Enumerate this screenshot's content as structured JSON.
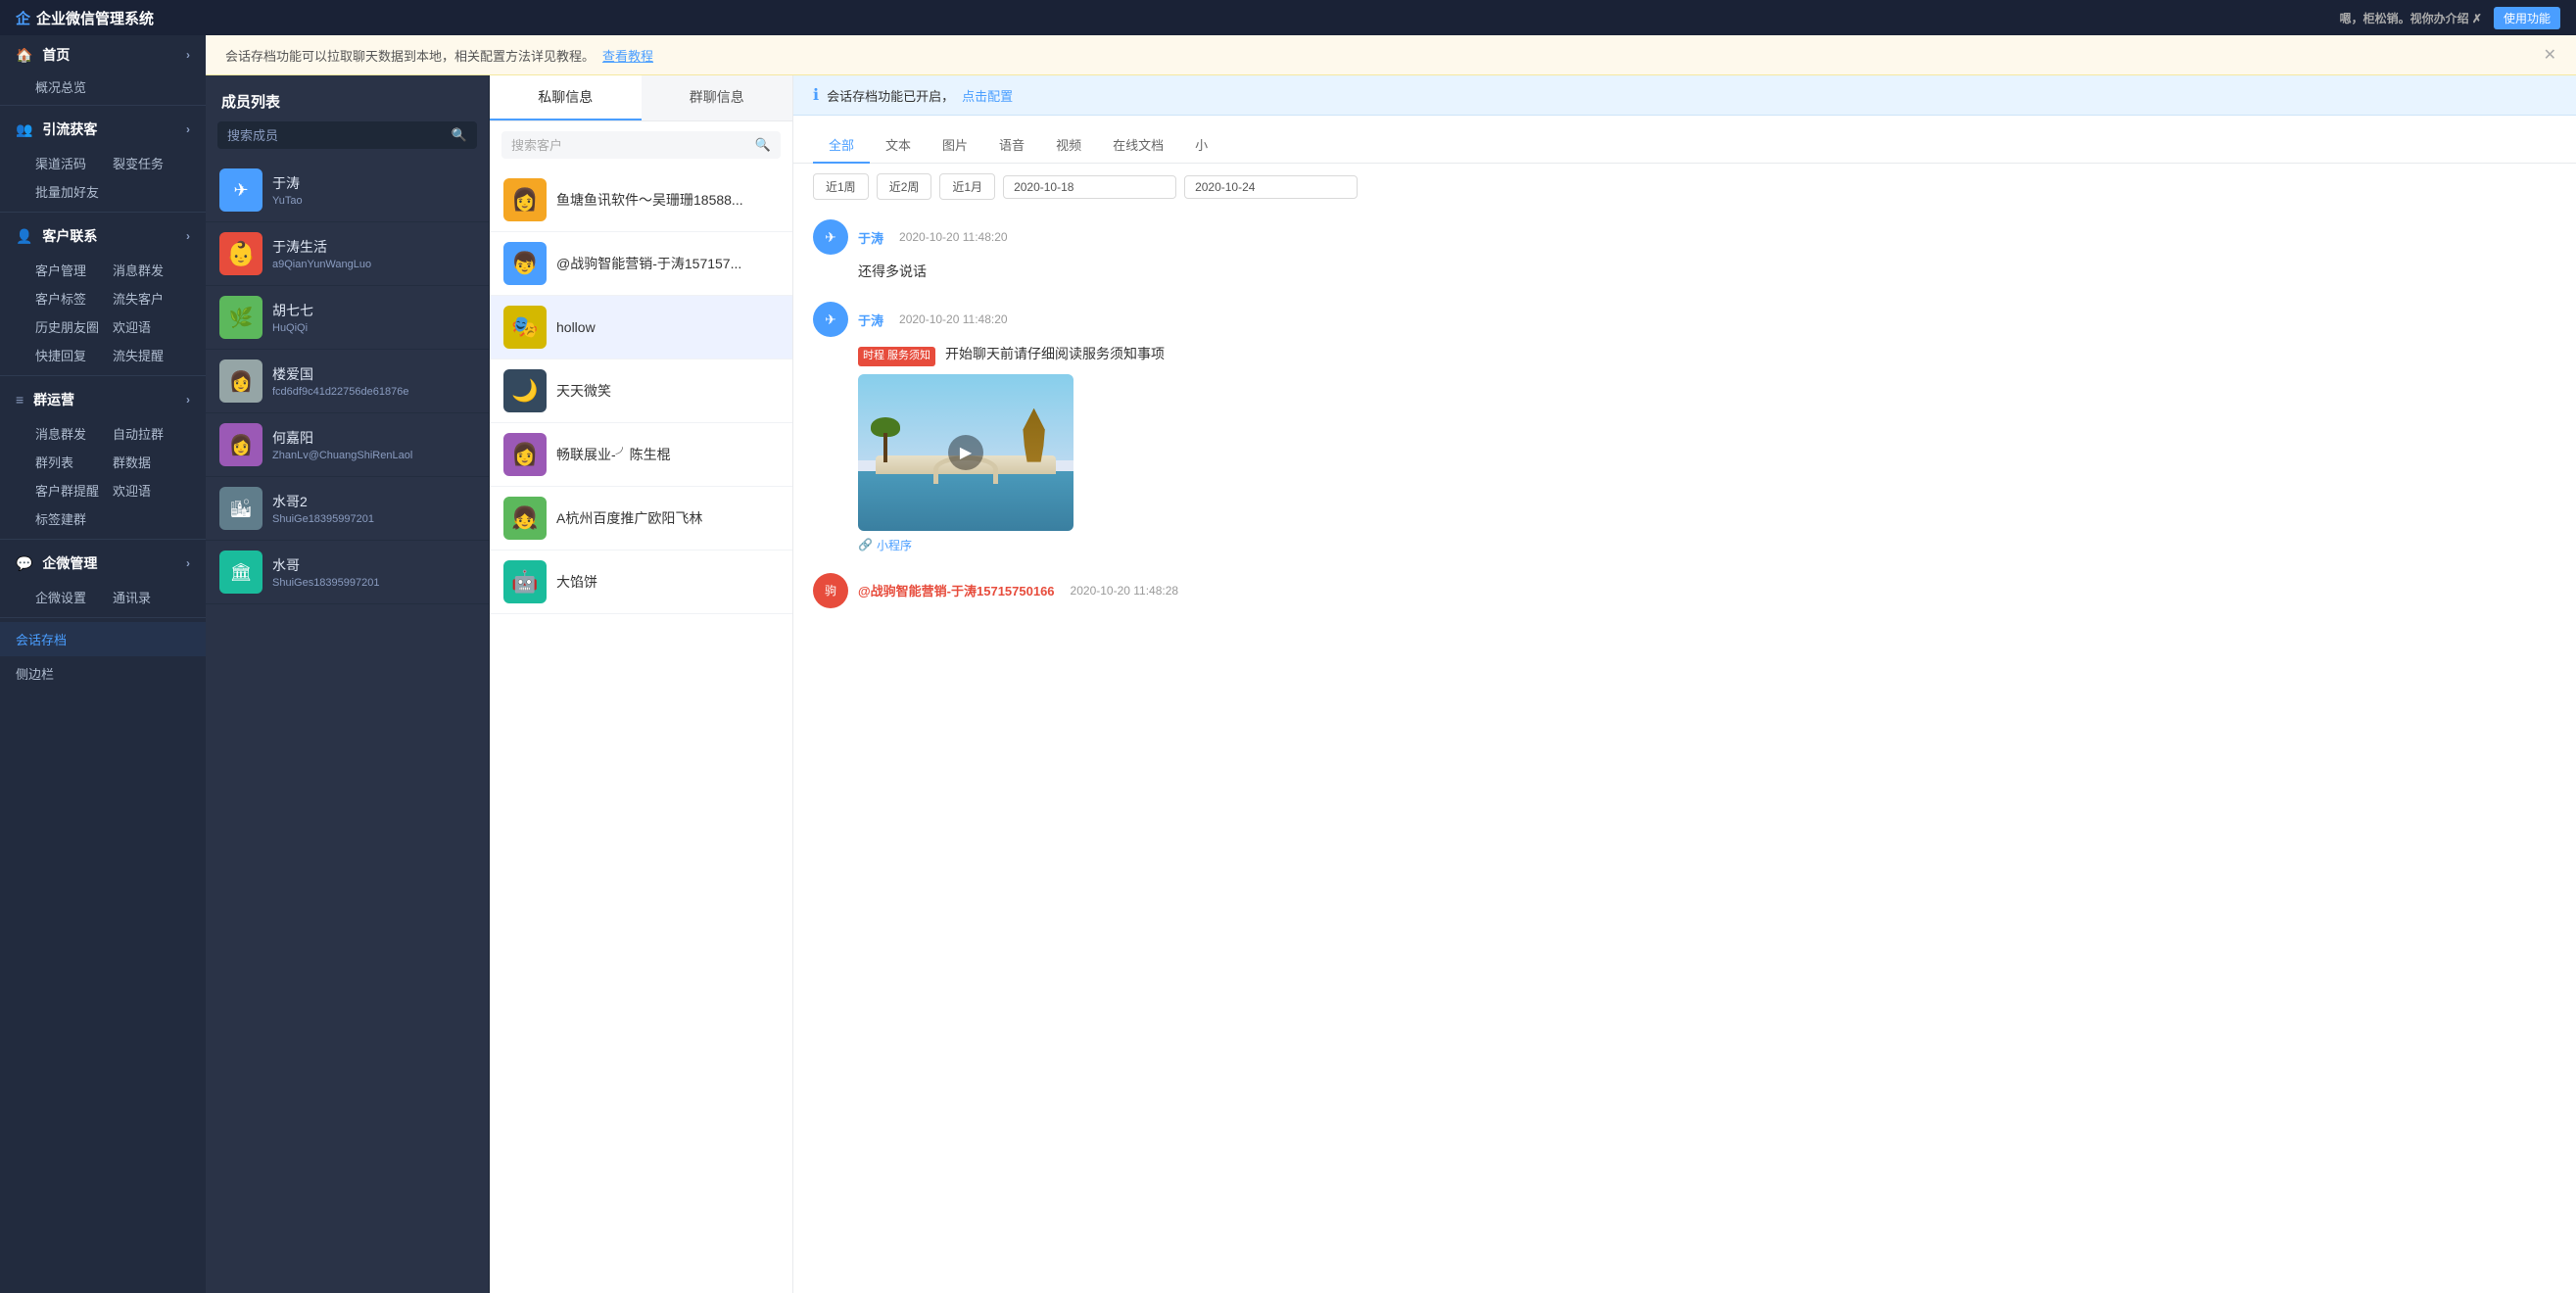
{
  "topbar": {
    "title": "企业微信管理系统",
    "right_text": "嗯，柜松销。视你办介绍  ✗",
    "use_button": "使用功能"
  },
  "sidebar": {
    "sections": [
      {
        "id": "home",
        "icon": "🏠",
        "label": "首页",
        "has_arrow": true,
        "sub_items": [
          {
            "label": "概况总览"
          }
        ]
      },
      {
        "id": "attract",
        "icon": "👥",
        "label": "引流获客",
        "has_arrow": true,
        "sub_grid": [
          "渠道活码",
          "裂变任务",
          "批量加好友"
        ]
      },
      {
        "id": "customer",
        "icon": "👤",
        "label": "客户联系",
        "has_arrow": true,
        "sub_grid": [
          "客户管理",
          "消息群发",
          "客户标签",
          "流失客户",
          "历史朋友圈",
          "欢迎语",
          "快捷回复",
          "流失提醒"
        ]
      },
      {
        "id": "group",
        "icon": "≡",
        "label": "群运营",
        "has_arrow": true,
        "sub_grid": [
          "消息群发",
          "自动拉群",
          "群列表",
          "群数据",
          "客户群提醒",
          "欢迎语",
          "标签建群"
        ]
      },
      {
        "id": "corp",
        "icon": "💬",
        "label": "企微管理",
        "has_arrow": true,
        "sub_grid": [
          "企微设置",
          "通讯录"
        ]
      }
    ],
    "bottom_items": [
      "会话存档",
      "侧边栏"
    ]
  },
  "member_panel": {
    "title": "成员列表",
    "search_placeholder": "搜索成员",
    "members": [
      {
        "id": "yutao",
        "name": "于涛",
        "sub": "YuTao",
        "avatar_color": "blue",
        "avatar_text": "✈"
      },
      {
        "id": "yutaoshenghuo",
        "name": "于涛生活",
        "sub": "a9QianYunWangLuo",
        "avatar_color": "red",
        "avatar_text": "👶"
      },
      {
        "id": "huqiqi",
        "name": "胡七七",
        "sub": "HuQiQi",
        "avatar_color": "green",
        "avatar_text": "🌿"
      },
      {
        "id": "louaiguo",
        "name": "楼爱国",
        "sub": "fcd6df9c41d22756de61876e",
        "avatar_color": "gray",
        "avatar_text": "👩"
      },
      {
        "id": "hejiayang",
        "name": "何嘉阳",
        "sub": "ZhanLv@ChuangShiRenLaol",
        "avatar_color": "purple",
        "avatar_text": "👩"
      },
      {
        "id": "shuige2",
        "name": "水哥2",
        "sub": "ShuiGe18395997201",
        "avatar_color": "orange",
        "avatar_text": "🏙"
      },
      {
        "id": "shuige",
        "name": "水哥",
        "sub": "ShuiGes18395997201",
        "avatar_color": "teal",
        "avatar_text": "🏛"
      }
    ]
  },
  "chat_panel": {
    "tabs": [
      "私聊信息",
      "群聊信息"
    ],
    "active_tab": "私聊信息",
    "search_placeholder": "搜索客户",
    "chats": [
      {
        "id": "yutang",
        "name": "鱼塘鱼讯软件～吴珊珊18588...",
        "avatar_color": "orange",
        "avatar_text": "👩"
      },
      {
        "id": "zhanjiao",
        "name": "@战驹智能营销-于涛157157...",
        "avatar_color": "blue",
        "avatar_text": "👦"
      },
      {
        "id": "hollow",
        "name": "hollow",
        "avatar_color": "yellow",
        "avatar_text": "🎭",
        "active": true
      },
      {
        "id": "tianxiao",
        "name": "天天微笑",
        "avatar_color": "gray",
        "avatar_text": "🌙"
      },
      {
        "id": "chang",
        "name": "畅联展业-╯陈生棍",
        "avatar_color": "purple",
        "avatar_text": "👩"
      },
      {
        "id": "hangzhou",
        "name": "A杭州百度推广欧阳飞林",
        "avatar_color": "green",
        "avatar_text": "👧"
      },
      {
        "id": "dajianbing",
        "name": "大馅饼",
        "avatar_color": "teal",
        "avatar_text": "🤖"
      }
    ]
  },
  "message_area": {
    "info_bar": {
      "text": "会话存档功能已开启，",
      "link": "点击配置"
    },
    "filter_tabs": [
      "全部",
      "文本",
      "图片",
      "语音",
      "视频",
      "在线文档",
      "小"
    ],
    "active_filter": "全部",
    "date_buttons": [
      "近1周",
      "近2周",
      "近1月"
    ],
    "date_from": "2020-10-18",
    "date_to": "2020-10-24",
    "messages": [
      {
        "id": "msg1",
        "sender": "于涛",
        "sender_color": "blue",
        "time": "2020-10-20 11:48:20",
        "content_type": "text",
        "text": "还得多说话"
      },
      {
        "id": "msg2",
        "sender": "于涛",
        "sender_color": "blue",
        "time": "2020-10-20 11:48:20",
        "content_type": "service_notice",
        "service_tag": "服务须知",
        "text": "开始聊天前请仔细阅读服务须知事项",
        "has_image": true,
        "mini_program": "小程序"
      },
      {
        "id": "msg3",
        "sender": "@战驹智能营销-于涛15715750166",
        "sender_color": "red",
        "time": "2020-10-20 11:48:28",
        "content_type": "text",
        "text": ""
      }
    ]
  },
  "colors": {
    "sidebar_bg": "#222b3e",
    "accent": "#4a9eff",
    "active_tab_border": "#4a9eff",
    "notice_bg": "#fef9ec",
    "info_bar_bg": "#e8f4ff"
  }
}
